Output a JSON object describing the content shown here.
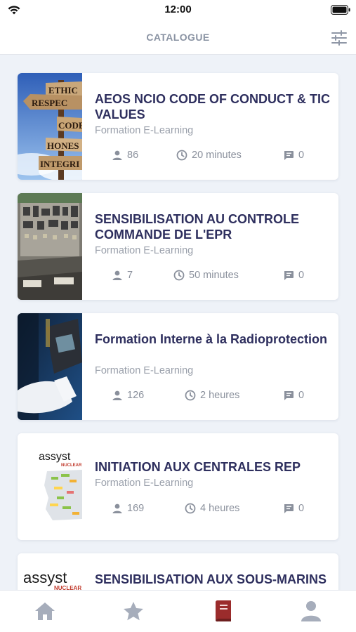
{
  "status_bar": {
    "time": "12:00"
  },
  "header": {
    "title": "CATALOGUE"
  },
  "courses": [
    {
      "title": "AEOS NCIO CODE OF CONDUCT & TIC VALUES",
      "subtitle": "Formation E-Learning",
      "learners": "86",
      "duration": "20 minutes",
      "comments": "0"
    },
    {
      "title": "SENSIBILISATION AU CONTROLE COMMANDE DE L'EPR",
      "subtitle": "Formation E-Learning",
      "learners": "7",
      "duration": "50 minutes",
      "comments": "0"
    },
    {
      "title": "Formation Interne à la Radioprotection",
      "subtitle": "Formation E-Learning",
      "learners": "126",
      "duration": "2 heures",
      "comments": "0"
    },
    {
      "title": "INITIATION AUX CENTRALES REP",
      "subtitle": "Formation E-Learning",
      "learners": "169",
      "duration": "4 heures",
      "comments": "0"
    },
    {
      "title": "SENSIBILISATION AUX SOUS-MARINS NUCLEAIRES",
      "subtitle": "",
      "learners": "",
      "duration": "",
      "comments": ""
    }
  ],
  "thumbnails": {
    "ethics_signs": [
      "ETHIC",
      "RESPEC",
      "CODE",
      "HONES",
      "INTEGRI"
    ],
    "logo_text": "assyst",
    "logo_sub": "NUCLEAR"
  },
  "tabs": [
    {
      "name": "home",
      "icon": "home-icon",
      "active": false
    },
    {
      "name": "favorites",
      "icon": "star-icon",
      "active": false
    },
    {
      "name": "catalogue",
      "icon": "book-icon",
      "active": true
    },
    {
      "name": "profile",
      "icon": "user-icon",
      "active": false
    }
  ],
  "colors": {
    "title": "#2e2f5e",
    "muted": "#9aa0ab",
    "accent": "#9b2c2c",
    "tab_inactive": "#a6adbb",
    "background": "#eef2f8"
  }
}
